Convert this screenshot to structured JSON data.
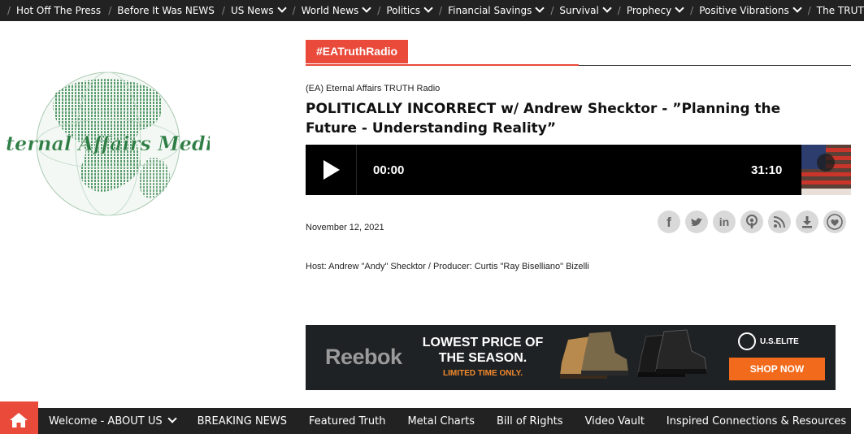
{
  "top_nav": {
    "items": [
      {
        "label": "Hot Off The Press",
        "dropdown": false
      },
      {
        "label": "Before It Was NEWS",
        "dropdown": false
      },
      {
        "label": "US News",
        "dropdown": true
      },
      {
        "label": "World News",
        "dropdown": true
      },
      {
        "label": "Politics",
        "dropdown": true
      },
      {
        "label": "Financial Savings",
        "dropdown": true
      },
      {
        "label": "Survival",
        "dropdown": true
      },
      {
        "label": "Prophecy",
        "dropdown": true
      },
      {
        "label": "Positive Vibrations",
        "dropdown": true
      },
      {
        "label": "The TRUTH",
        "dropdown": true
      }
    ]
  },
  "logo": {
    "text": "Eternal Affairs Media",
    "color": "#2e7d44"
  },
  "post": {
    "category_tag": "#EATruthRadio",
    "subtitle": "(EA) Eternal Affairs TRUTH Radio",
    "title": "POLITICALLY INCORRECT w/ Andrew Shecktor - ”Planning the Future - Understanding Reality”",
    "date": "November 12, 2021",
    "host_line": "Host: Andrew \"Andy\" Shecktor / Producer: Curtis \"Ray Biselliano\" Bizelli"
  },
  "player": {
    "current_time": "00:00",
    "duration": "31:10",
    "progress": 0
  },
  "share_icons": [
    "facebook-icon",
    "twitter-icon",
    "linkedin-icon",
    "podcast-icon",
    "rss-icon",
    "download-icon",
    "heart-icon"
  ],
  "ad": {
    "brand": "Reebok",
    "line1": "LOWEST PRICE OF",
    "line2": "THE SEASON.",
    "line3": "LIMITED TIME ONLY.",
    "logo": "U.S.ELITE",
    "cta": "SHOP NOW",
    "accent": "#f26b1d"
  },
  "bottom_nav": {
    "items": [
      {
        "label": "Welcome - ABOUT US",
        "dropdown": true
      },
      {
        "label": "BREAKING NEWS",
        "dropdown": false
      },
      {
        "label": "Featured Truth",
        "dropdown": false
      },
      {
        "label": "Metal Charts",
        "dropdown": false
      },
      {
        "label": "Bill of Rights",
        "dropdown": false
      },
      {
        "label": "Video Vault",
        "dropdown": false
      },
      {
        "label": "Inspired Connections & Resources",
        "dropdown": true
      }
    ]
  },
  "colors": {
    "accent": "#e94a3a",
    "nav_bg": "#222222"
  }
}
